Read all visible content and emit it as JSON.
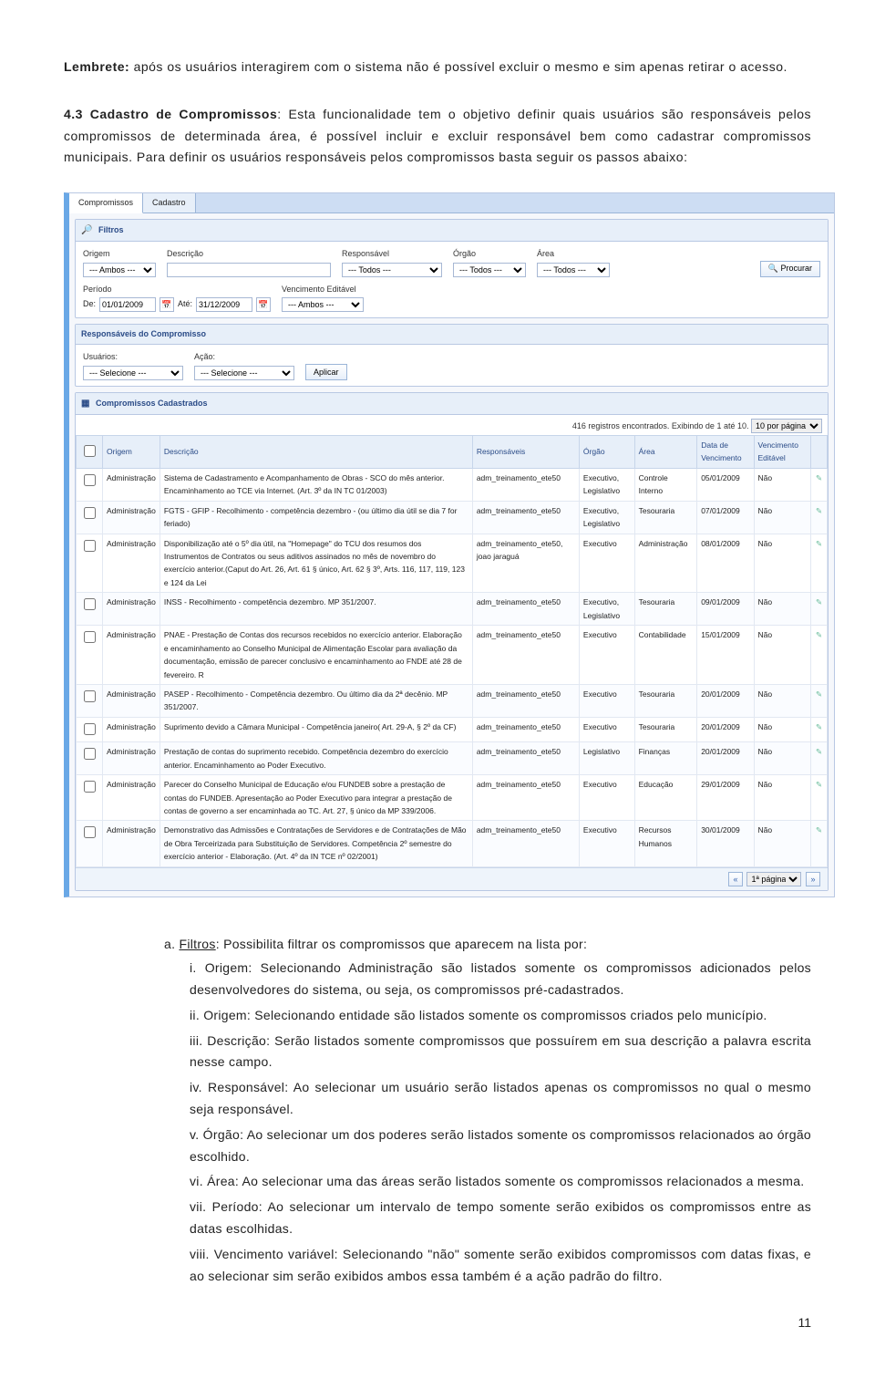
{
  "lembrete": {
    "label": "Lembrete:",
    "text": "após os usuários interagirem com o sistema não é possível excluir o mesmo e sim apenas retirar o acesso."
  },
  "section": {
    "num": "4.3",
    "title_bold": "Cadastro de Compromissos",
    "body": ": Esta funcionalidade tem o objetivo definir quais usuários são responsáveis pelos compromissos de determinada área, é possível incluir e excluir responsável bem como cadastrar compromissos municipais. Para definir os usuários responsáveis pelos compromissos basta seguir os passos abaixo:"
  },
  "shot": {
    "tabs": [
      "Compromissos",
      "Cadastro"
    ],
    "filters_title": "Filtros",
    "labels": {
      "origem": "Origem",
      "descricao": "Descrição",
      "responsavel": "Responsável",
      "orgao": "Órgão",
      "area": "Área",
      "periodo": "Período",
      "de": "De:",
      "ate": "Até:",
      "venc_editavel": "Vencimento Editável"
    },
    "values": {
      "origem": "--- Ambos ---",
      "descricao": "",
      "responsavel": "--- Todos ---",
      "orgao": "--- Todos ---",
      "area": "--- Todos ---",
      "de": "01/01/2009",
      "ate": "31/12/2009",
      "venc": "--- Ambos ---"
    },
    "btn_procurar": "Procurar",
    "resp_title": "Responsáveis do Compromisso",
    "resp_labels": {
      "usuarios": "Usuários:",
      "acao": "Ação:"
    },
    "resp_values": {
      "usuarios": "--- Selecione ---",
      "acao": "--- Selecione ---"
    },
    "btn_aplicar": "Aplicar",
    "grid_title": "Compromissos Cadastrados",
    "grid_meta_a": "416 registros encontrados. Exibindo de 1 até 10.",
    "grid_meta_pp": "10 por página",
    "grid_headers": [
      "",
      "Origem",
      "Descrição",
      "Responsáveis",
      "Órgão",
      "Área",
      "Data de Vencimento",
      "Vencimento Editável",
      ""
    ],
    "rows": [
      {
        "origem": "Administração",
        "desc": "Sistema de Cadastramento e Acompanhamento de Obras - SCO do mês anterior. Encaminhamento ao TCE via Internet. (Art. 3º da IN TC 01/2003)",
        "resp": "adm_treinamento_ete50",
        "orgao": "Executivo, Legislativo",
        "area": "Controle Interno",
        "data": "05/01/2009",
        "venc": "Não"
      },
      {
        "origem": "Administração",
        "desc": "FGTS - GFIP - Recolhimento - competência dezembro - (ou último dia útil se dia 7 for feriado)",
        "resp": "adm_treinamento_ete50",
        "orgao": "Executivo, Legislativo",
        "area": "Tesouraria",
        "data": "07/01/2009",
        "venc": "Não"
      },
      {
        "origem": "Administração",
        "desc": "Disponibilização até o 5º dia útil, na \"Homepage\" do TCU dos resumos dos Instrumentos de Contratos ou seus aditivos assinados no mês de novembro do exercício anterior.(Caput do Art. 26, Art. 61 § único, Art. 62 § 3º, Arts. 116, 117, 119, 123 e 124 da Lei",
        "resp": "adm_treinamento_ete50, joao jaraguá",
        "orgao": "Executivo",
        "area": "Administração",
        "data": "08/01/2009",
        "venc": "Não"
      },
      {
        "origem": "Administração",
        "desc": "INSS - Recolhimento - competência dezembro. MP 351/2007.",
        "resp": "adm_treinamento_ete50",
        "orgao": "Executivo, Legislativo",
        "area": "Tesouraria",
        "data": "09/01/2009",
        "venc": "Não"
      },
      {
        "origem": "Administração",
        "desc": "PNAE - Prestação de Contas dos recursos recebidos no exercício anterior. Elaboração e encaminhamento ao Conselho Municipal de Alimentação Escolar para avaliação da documentação, emissão de parecer conclusivo e encaminhamento ao FNDE até 28 de fevereiro. R",
        "resp": "adm_treinamento_ete50",
        "orgao": "Executivo",
        "area": "Contabilidade",
        "data": "15/01/2009",
        "venc": "Não"
      },
      {
        "origem": "Administração",
        "desc": "PASEP - Recolhimento - Competência dezembro. Ou último dia da 2ª decênio. MP 351/2007.",
        "resp": "adm_treinamento_ete50",
        "orgao": "Executivo",
        "area": "Tesouraria",
        "data": "20/01/2009",
        "venc": "Não"
      },
      {
        "origem": "Administração",
        "desc": "Suprimento devido a Câmara Municipal - Competência janeiro( Art. 29-A, § 2º da CF)",
        "resp": "adm_treinamento_ete50",
        "orgao": "Executivo",
        "area": "Tesouraria",
        "data": "20/01/2009",
        "venc": "Não"
      },
      {
        "origem": "Administração",
        "desc": "Prestação de contas do suprimento recebido. Competência dezembro do exercício anterior. Encaminhamento ao Poder Executivo.",
        "resp": "adm_treinamento_ete50",
        "orgao": "Legislativo",
        "area": "Finanças",
        "data": "20/01/2009",
        "venc": "Não"
      },
      {
        "origem": "Administração",
        "desc": "Parecer do Conselho Municipal de Educação e/ou FUNDEB sobre a prestação de contas do FUNDEB. Apresentação ao Poder Executivo para integrar a prestação de contas de governo a ser encaminhada ao TC. Art. 27, § único da MP 339/2006.",
        "resp": "adm_treinamento_ete50",
        "orgao": "Executivo",
        "area": "Educação",
        "data": "29/01/2009",
        "venc": "Não"
      },
      {
        "origem": "Administração",
        "desc": "Demonstrativo das Admissões e Contratações de Servidores e de Contratações de Mão de Obra Terceirizada para Substituição de Servidores. Competência 2º semestre do exercício anterior - Elaboração. (Art. 4º da IN TCE nº 02/2001)",
        "resp": "adm_treinamento_ete50",
        "orgao": "Executivo",
        "area": "Recursos Humanos",
        "data": "30/01/2009",
        "venc": "Não"
      }
    ],
    "pager_page": "1ª página"
  },
  "list": {
    "a": {
      "marker": "a.",
      "lead": "Filtros",
      "rest": ": Possibilita filtrar os compromissos que aparecem na lista por:"
    },
    "items": [
      {
        "m": "i.",
        "text": "Origem: Selecionando Administração são listados somente os compromissos adicionados pelos desenvolvedores do sistema, ou seja, os compromissos pré-cadastrados."
      },
      {
        "m": "ii.",
        "text": "Origem: Selecionando entidade são listados somente os compromissos criados pelo município."
      },
      {
        "m": "iii.",
        "text": "Descrição: Serão listados somente compromissos que possuírem em sua descrição a palavra escrita nesse campo."
      },
      {
        "m": "iv.",
        "text": "Responsável: Ao selecionar um usuário serão listados apenas os compromissos no qual o mesmo seja responsável."
      },
      {
        "m": "v.",
        "text": "Órgão: Ao selecionar um dos poderes serão listados somente os compromissos relacionados ao órgão escolhido."
      },
      {
        "m": "vi.",
        "text": "Área: Ao selecionar uma das áreas serão listados somente os compromissos relacionados a mesma."
      },
      {
        "m": "vii.",
        "text": "Período: Ao selecionar um intervalo de tempo somente serão exibidos os compromissos entre as datas escolhidas."
      },
      {
        "m": "viii.",
        "text": "Vencimento variável: Selecionando \"não\" somente serão exibidos compromissos com datas fixas, e ao selecionar sim serão exibidos ambos essa também é a ação padrão do filtro."
      }
    ]
  },
  "page_number": "11"
}
